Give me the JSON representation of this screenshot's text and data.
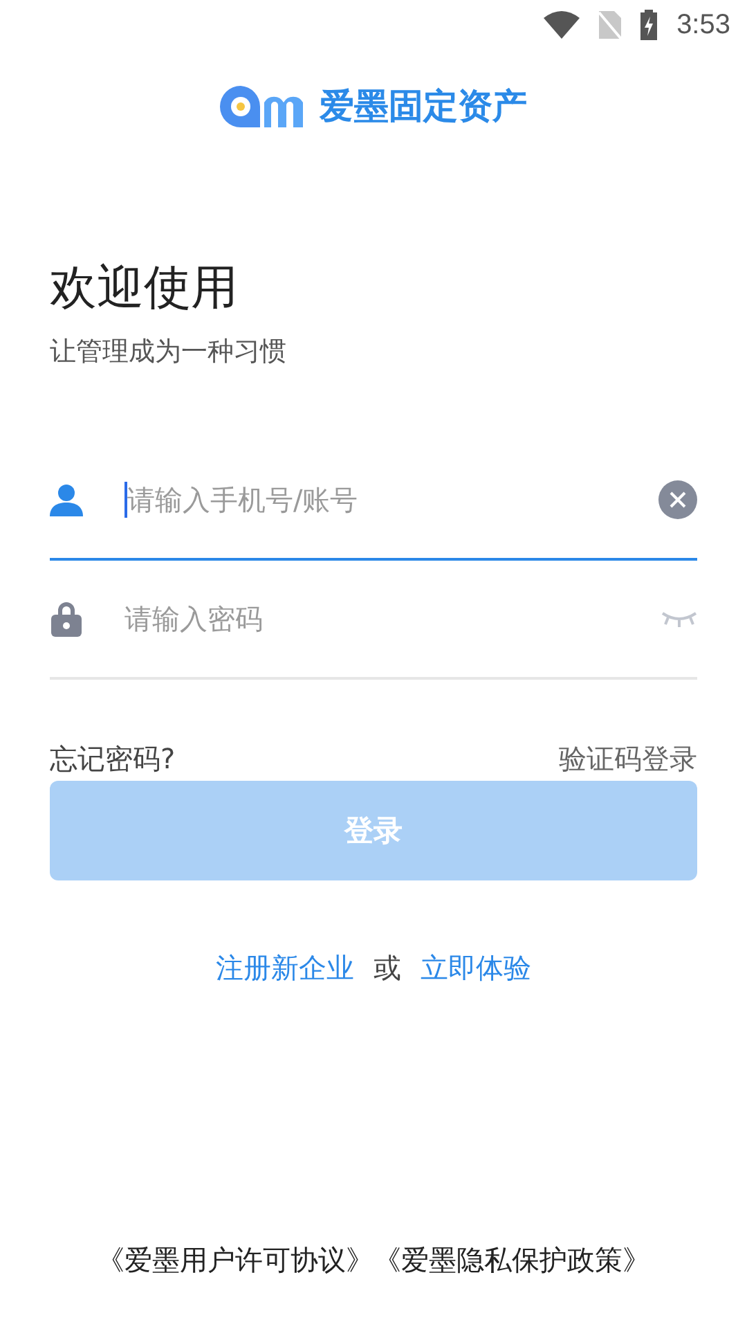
{
  "status_bar": {
    "time": "3:53"
  },
  "brand": {
    "name": "爱墨固定资产"
  },
  "heading": {
    "title": "欢迎使用",
    "subtitle": "让管理成为一种习惯"
  },
  "fields": [
    {
      "kind": "account",
      "placeholder": "请输入手机号/账号",
      "focused": true
    },
    {
      "kind": "password",
      "placeholder": "请输入密码",
      "focused": false
    }
  ],
  "links": {
    "forgot": "忘记密码?",
    "sms_login": "验证码登录"
  },
  "login_button": {
    "label": "登录",
    "disabled": true
  },
  "register": {
    "left": "注册新企业",
    "separator": "或",
    "right": "立即体验"
  },
  "footer": {
    "agreements": [
      "《爱墨用户许可协议》",
      "《爱墨隐私保护政策》"
    ]
  }
}
